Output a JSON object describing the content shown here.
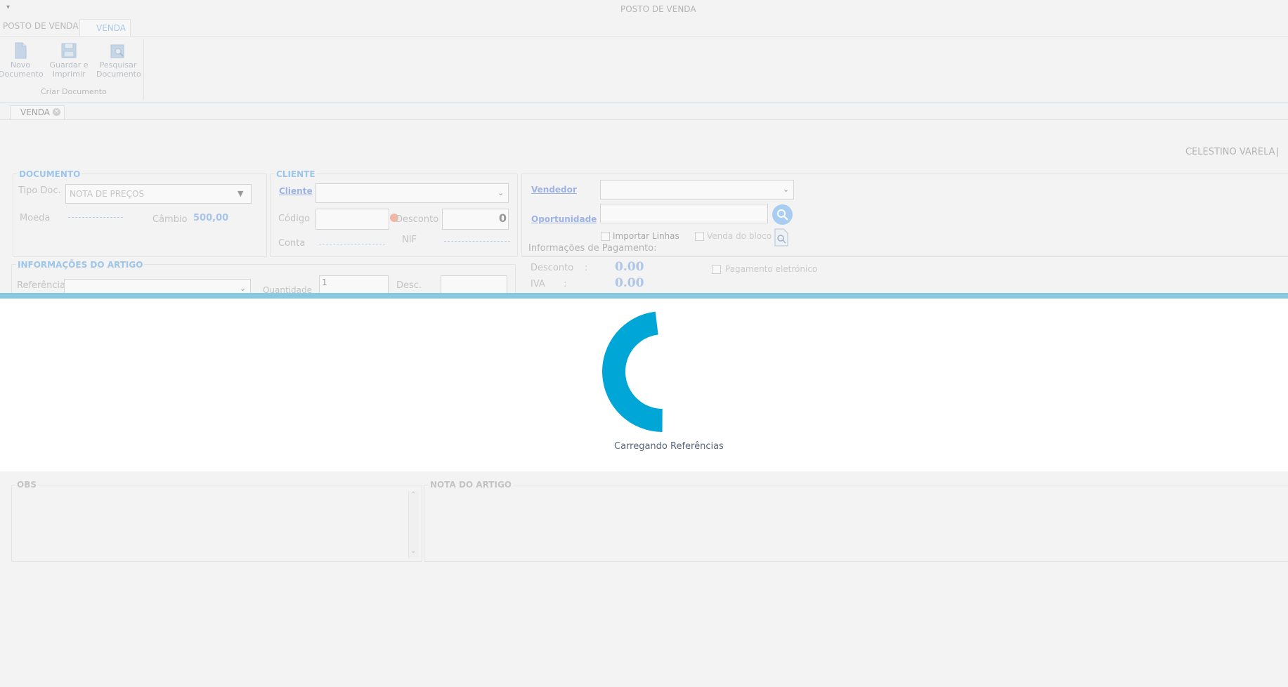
{
  "window": {
    "title": "POSTO DE VENDA",
    "menu_glyph": "▾"
  },
  "ribbon": {
    "tabs": [
      "POSTO DE VENDA",
      "VENDA"
    ],
    "buttons": [
      {
        "label1": "Novo",
        "label2": "Documento",
        "icon": "new-document-icon"
      },
      {
        "label1": "Guardar e",
        "label2": "Imprimir",
        "icon": "save-print-icon"
      },
      {
        "label1": "Pesquisar",
        "label2": "Documento",
        "icon": "search-document-icon"
      }
    ],
    "group_label": "Criar Documento"
  },
  "doc_tab": {
    "label": "VENDA",
    "close_glyph": "×"
  },
  "user": {
    "name": "CELESTINO VARELA",
    "separator": "|"
  },
  "documento": {
    "title": "DOCUMENTO",
    "tipo_doc_label": "Tipo Doc.",
    "tipo_doc_value": "NOTA DE PREÇOS",
    "moeda_label": "Moeda",
    "cambio_label": "Câmbio",
    "cambio_value": "500,00"
  },
  "cliente": {
    "title": "CLIENTE",
    "cliente_link": "Cliente",
    "codigo_label": "Código",
    "desconto_label": "Desconto",
    "desconto_value": "0",
    "conta_label": "Conta",
    "nif_label": "NIF"
  },
  "vendedor": {
    "vendedor_link": "Vendedor",
    "oportunidade_link": "Oportunidade",
    "importar_linhas": "Importar Linhas",
    "venda_do_bloco": "Venda do bloco"
  },
  "pagamento": {
    "title": "Informações de Pagamento:",
    "desconto_label": "Desconto",
    "desconto_value": "0.00",
    "iva_label": "IVA",
    "iva_value": "0.00",
    "colon": ":",
    "pagamento_eletronico": "Pagamento eletrónico"
  },
  "artigo": {
    "title": "INFORMAÇÕES DO ARTIGO",
    "referencia_label": "Referência",
    "quantidade_label": "Quantidade",
    "quantidade_value": "1",
    "desc_label": "Desc."
  },
  "loading": {
    "text": "Carregando Referências",
    "progress": 0.6
  },
  "obs": {
    "title": "OBS"
  },
  "nota_artigo": {
    "title": "NOTA DO ARTIGO"
  },
  "colors": {
    "accent": "#00a6d6",
    "overlay_bar": "#86c9e0",
    "link": "#9db2e6"
  }
}
